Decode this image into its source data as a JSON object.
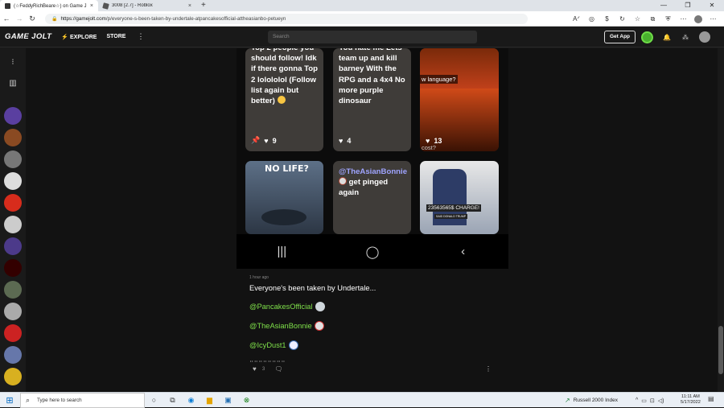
{
  "browser": {
    "tabs": [
      {
        "title": "(☆FeddyRichBeare☆) on Game J",
        "close": "×",
        "active": true
      },
      {
        "title": "3008 [2.7] - Roblox",
        "close": "×",
        "active": false
      }
    ],
    "new_tab": "+",
    "window_controls": [
      "—",
      "❐",
      "✕"
    ],
    "url_host": "https://gamejolt.com",
    "url_path": "/p/everyone-s-been-taken-by-undertale-atpancakesofficial-attheasianbo-petueyn",
    "nav": {
      "back": "←",
      "forward": "→",
      "reload": "↻"
    }
  },
  "gamejolt": {
    "logo": "GAME JOLT",
    "nav": {
      "explore": "EXPLORE",
      "store": "STORE",
      "more": "⋮"
    },
    "search_placeholder": "Search",
    "get_app": "Get App"
  },
  "phone": {
    "cards": [
      {
        "text": "Top 2 people you should follow! Idk if there gonna Top 2 lolololol (Follow list again but better)",
        "likes": "9"
      },
      {
        "text": "You hate me Lets team up and kill barney With the RPG and a 4x4 No more purple dinosaur",
        "likes": "4"
      },
      {
        "caption_top": "w language?",
        "caption_bottom": "cost?",
        "likes": "13"
      },
      {
        "caption": "NO LIFE?"
      },
      {
        "mention": "@TheAsianBonnie",
        "text": "get pinged again"
      },
      {
        "caption": "23563565$ CHARGE!",
        "subcaption": "SAID DONALD TRUMP"
      }
    ],
    "nav_buttons": [
      "|||",
      "◯",
      "‹"
    ]
  },
  "post": {
    "time_ago": "1 hour ago",
    "title": "Everyone's been taken by Undertale...",
    "mentions": [
      "@PancakesOfficial",
      "@TheAsianBonnie",
      "@IcyDust1"
    ],
    "dots": "⠒⠒⠒⠒⠒⠒⠒⠒",
    "likes": "3"
  },
  "taskbar": {
    "search_placeholder": "Type here to search",
    "market": "Russell 2000 Index",
    "time": "11:11 AM",
    "date": "5/17/2022"
  },
  "colors": {
    "accent_green": "#7fe04a",
    "mention_blue": "#9fa4ff",
    "card_bg": "#3f3c39"
  }
}
